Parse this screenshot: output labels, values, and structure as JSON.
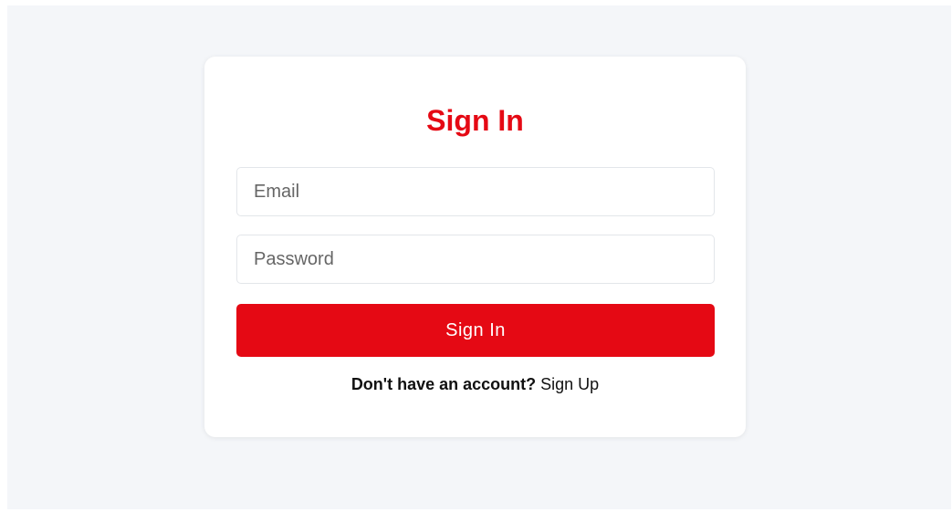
{
  "form": {
    "title": "Sign In",
    "email_placeholder": "Email",
    "email_value": "",
    "password_placeholder": "Password",
    "password_value": "",
    "submit_label": "Sign In",
    "signup_prompt": "Don't have an account?",
    "signup_link": "Sign Up"
  },
  "colors": {
    "accent": "#e50914",
    "background": "#f4f6f9",
    "card": "#ffffff"
  }
}
